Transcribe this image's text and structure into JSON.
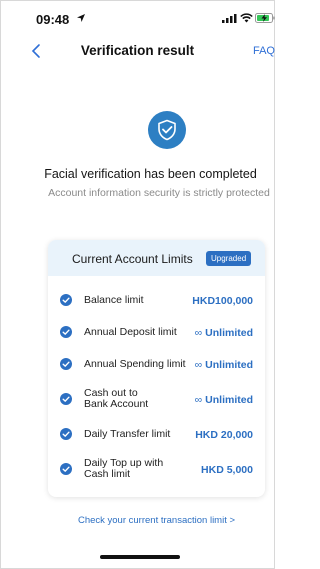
{
  "status": {
    "time": "09:48"
  },
  "nav": {
    "title": "Verification result",
    "faq": "FAQ"
  },
  "hero": {
    "headline": "Facial verification has been completed",
    "subline": "Account information security is strictly protected"
  },
  "card": {
    "title": "Current Account Limits",
    "badge": "Upgraded",
    "rows": [
      {
        "label": "Balance limit",
        "value": "HKD100,000",
        "infinite": false
      },
      {
        "label": "Annual Deposit limit",
        "value": "Unlimited",
        "infinite": true
      },
      {
        "label": "Annual Spending limit",
        "value": "Unlimited",
        "infinite": true
      },
      {
        "label": "Cash out to Bank Account",
        "value": "Unlimited",
        "infinite": true
      },
      {
        "label": "Daily Transfer limit",
        "value": "HKD 20,000",
        "infinite": false
      },
      {
        "label": "Daily Top up with Cash limit",
        "value": "HKD 5,000",
        "infinite": false
      }
    ]
  },
  "footer": {
    "link": "Check your current transaction limit >"
  },
  "colors": {
    "accent": "#2c6fc2",
    "header_bg": "#e9f3fb"
  },
  "icons": [
    "location-arrow-icon",
    "signal-icon",
    "wifi-icon",
    "battery-charging-icon",
    "back-chevron-icon",
    "shield-check-icon",
    "check-circle-icon"
  ]
}
